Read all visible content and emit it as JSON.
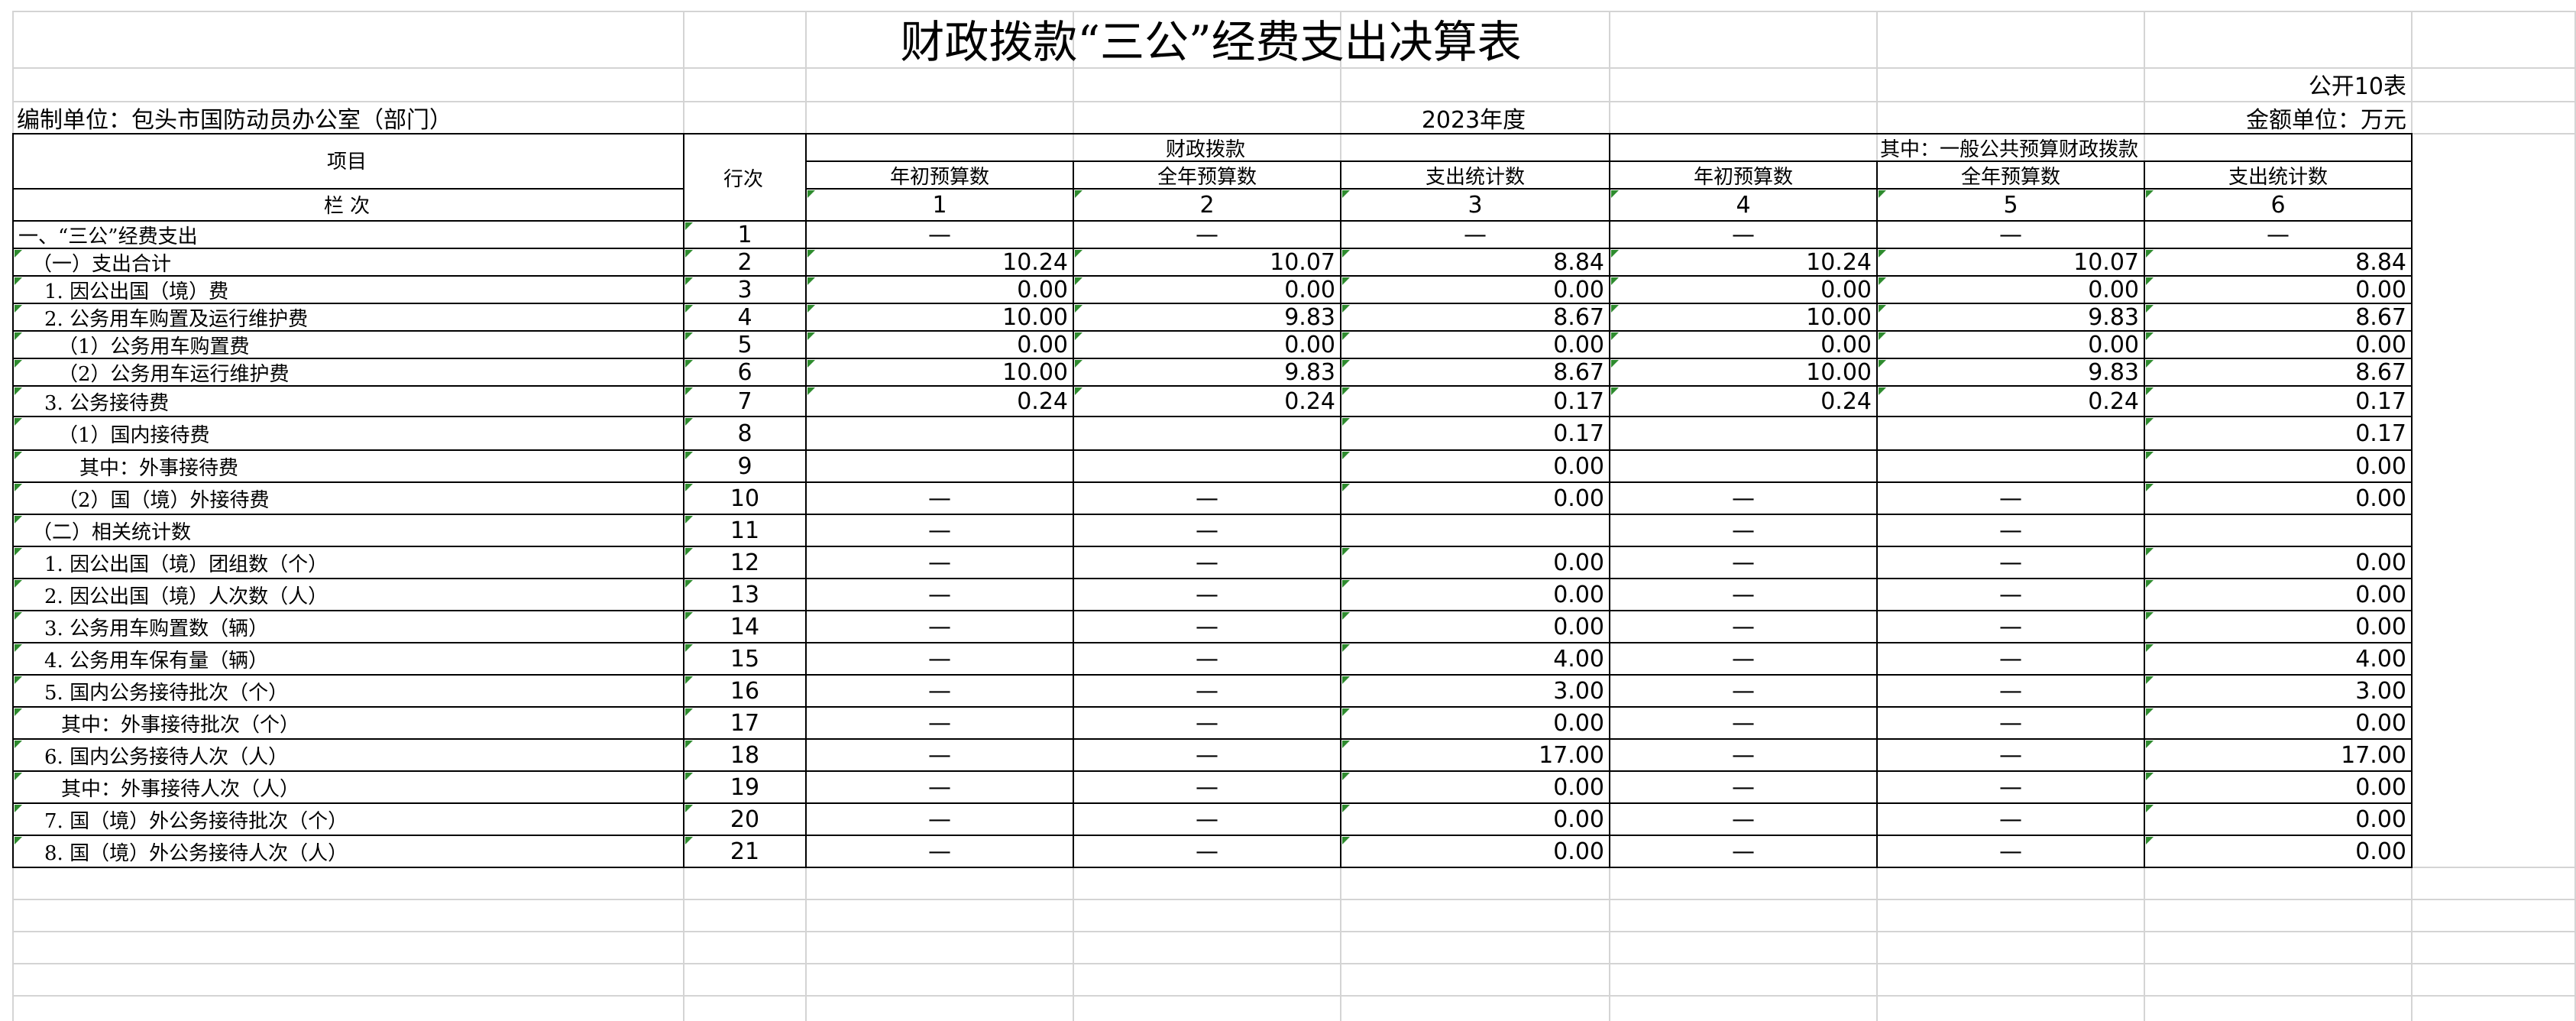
{
  "title": "财政拨款“三公”经费支出决算表",
  "form_no": "公开10表",
  "unit_label": "编制单位：包头市国防动员办公室（部门）",
  "year": "2023年度",
  "amount_unit": "金额单位：万元",
  "headers": {
    "item": "项目",
    "row_no": "行次",
    "column_seq": "栏  次",
    "group_fiscal": "财政拨款",
    "group_general": "其中：一般公共预算财政拨款",
    "sub_cols": [
      "年初预算数",
      "全年预算数",
      "支出统计数",
      "年初预算数",
      "全年预算数",
      "支出统计数"
    ],
    "col_numbers": [
      "1",
      "2",
      "3",
      "4",
      "5",
      "6"
    ]
  },
  "rows": [
    {
      "label": "一、“三公”经费支出",
      "no": "1",
      "values": [
        "—",
        "—",
        "—",
        "—",
        "—",
        "—"
      ]
    },
    {
      "label": "（一）支出合计",
      "no": "2",
      "values": [
        "10.24",
        "10.07",
        "8.84",
        "10.24",
        "10.07",
        "8.84"
      ]
    },
    {
      "label": "1.  因公出国（境）费",
      "no": "3",
      "values": [
        "0.00",
        "0.00",
        "0.00",
        "0.00",
        "0.00",
        "0.00"
      ]
    },
    {
      "label": "2.  公务用车购置及运行维护费",
      "no": "4",
      "values": [
        "10.00",
        "9.83",
        "8.67",
        "10.00",
        "9.83",
        "8.67"
      ]
    },
    {
      "label": "（1）公务用车购置费",
      "no": "5",
      "values": [
        "0.00",
        "0.00",
        "0.00",
        "0.00",
        "0.00",
        "0.00"
      ]
    },
    {
      "label": "（2）公务用车运行维护费",
      "no": "6",
      "values": [
        "10.00",
        "9.83",
        "8.67",
        "10.00",
        "9.83",
        "8.67"
      ]
    },
    {
      "label": "3.  公务接待费",
      "no": "7",
      "values": [
        "0.24",
        "0.24",
        "0.17",
        "0.24",
        "0.24",
        "0.17"
      ]
    },
    {
      "label": "（1）国内接待费",
      "no": "8",
      "values": [
        "",
        "",
        "0.17",
        "",
        "",
        "0.17"
      ]
    },
    {
      "label": "其中：外事接待费",
      "no": "9",
      "values": [
        "",
        "",
        "0.00",
        "",
        "",
        "0.00"
      ]
    },
    {
      "label": "（2）国（境）外接待费",
      "no": "10",
      "values": [
        "—",
        "—",
        "0.00",
        "—",
        "—",
        "0.00"
      ]
    },
    {
      "label": "（二）相关统计数",
      "no": "11",
      "values": [
        "—",
        "—",
        "",
        "—",
        "—",
        ""
      ]
    },
    {
      "label": "1.  因公出国（境）团组数（个）",
      "no": "12",
      "values": [
        "—",
        "—",
        "0.00",
        "—",
        "—",
        "0.00"
      ]
    },
    {
      "label": "2.  因公出国（境）人次数（人）",
      "no": "13",
      "values": [
        "—",
        "—",
        "0.00",
        "—",
        "—",
        "0.00"
      ]
    },
    {
      "label": "3.  公务用车购置数（辆）",
      "no": "14",
      "values": [
        "—",
        "—",
        "0.00",
        "—",
        "—",
        "0.00"
      ]
    },
    {
      "label": "4.  公务用车保有量（辆）",
      "no": "15",
      "values": [
        "—",
        "—",
        "4.00",
        "—",
        "—",
        "4.00"
      ]
    },
    {
      "label": "5.  国内公务接待批次（个）",
      "no": "16",
      "values": [
        "—",
        "—",
        "3.00",
        "—",
        "—",
        "3.00"
      ]
    },
    {
      "label": "其中：外事接待批次（个）",
      "no": "17",
      "values": [
        "—",
        "—",
        "0.00",
        "—",
        "—",
        "0.00"
      ]
    },
    {
      "label": "6.  国内公务接待人次（人）",
      "no": "18",
      "values": [
        "—",
        "—",
        "17.00",
        "—",
        "—",
        "17.00"
      ]
    },
    {
      "label": "其中：外事接待人次（人）",
      "no": "19",
      "values": [
        "—",
        "—",
        "0.00",
        "—",
        "—",
        "0.00"
      ]
    },
    {
      "label": "7.  国（境）外公务接待批次（个）",
      "no": "20",
      "values": [
        "—",
        "—",
        "0.00",
        "—",
        "—",
        "0.00"
      ]
    },
    {
      "label": "8.  国（境）外公务接待人次（人）",
      "no": "21",
      "values": [
        "—",
        "—",
        "0.00",
        "—",
        "—",
        "0.00"
      ]
    }
  ]
}
